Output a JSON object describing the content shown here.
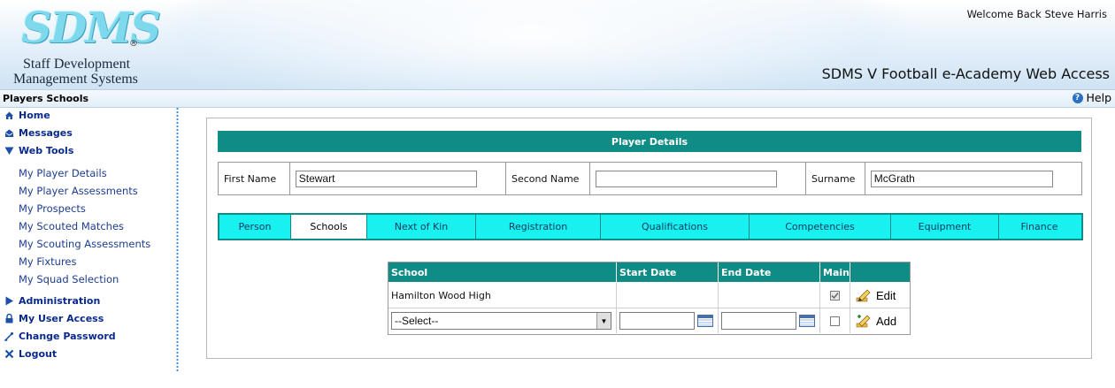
{
  "header": {
    "logo_text": "SDMS",
    "logo_reg": "®",
    "logo_line1": "Staff Development",
    "logo_line2": "Management Systems",
    "welcome": "Welcome Back Steve Harris",
    "app_title": "SDMS V Football e-Academy Web Access"
  },
  "pagebar": {
    "title": "Players Schools",
    "help": "Help",
    "help_icon": "question-circle-icon"
  },
  "sidebar": {
    "items": [
      {
        "label": "Home",
        "icon": "home-icon"
      },
      {
        "label": "Messages",
        "icon": "messages-icon"
      },
      {
        "label": "Web Tools",
        "icon": "triangle-down-icon"
      }
    ],
    "web_tools": [
      "My Player Details",
      "My Player Assessments",
      "My Prospects",
      "My Scouted Matches",
      "My Scouting Assessments",
      "My Fixtures",
      "My Squad Selection"
    ],
    "bottom_items": [
      {
        "label": "Administration",
        "icon": "triangle-right-icon"
      },
      {
        "label": "My User Access",
        "icon": "lock-icon"
      },
      {
        "label": "Change Password",
        "icon": "key-icon"
      },
      {
        "label": "Logout",
        "icon": "x-icon"
      }
    ]
  },
  "player": {
    "header": "Player Details",
    "first_name_label": "First Name",
    "first_name": "Stewart",
    "second_name_label": "Second Name",
    "second_name": "",
    "surname_label": "Surname",
    "surname": "McGrath"
  },
  "tabs": [
    "Person",
    "Schools",
    "Next of Kin",
    "Registration",
    "Qualifications",
    "Competencies",
    "Equipment",
    "Finance"
  ],
  "active_tab": "Schools",
  "schools_table": {
    "columns": [
      "School",
      "Start Date",
      "End Date",
      "Main",
      ""
    ],
    "rows": [
      {
        "school": "Hamilton Wood High",
        "start": "",
        "end": "",
        "main": true,
        "action": "Edit"
      }
    ],
    "new_row": {
      "select_value": "--Select--",
      "start": "",
      "end": "",
      "main": false,
      "action": "Add"
    }
  },
  "colors": {
    "teal": "#0e8c85",
    "cyan_tab": "#19f1f1",
    "nav_blue": "#0a2a8a"
  }
}
